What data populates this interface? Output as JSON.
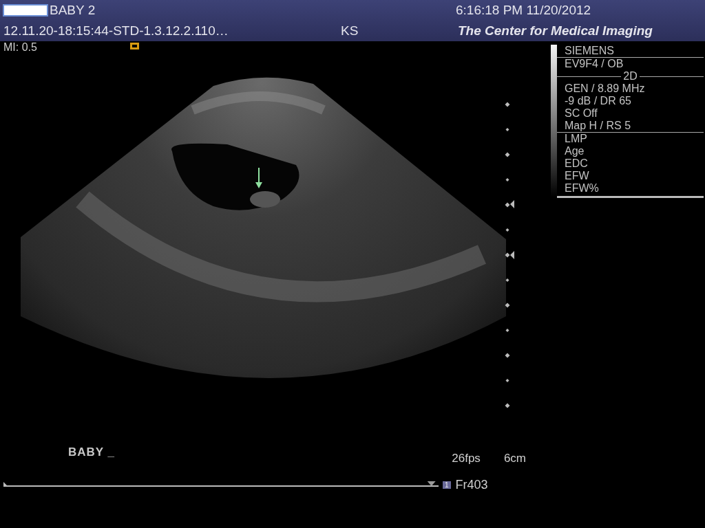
{
  "header": {
    "patient_name": "BABY 2",
    "datetime": "6:16:18 PM 11/20/2012",
    "study_id": "12.11.20-18:15:44-STD-1.3.12.2.110…",
    "operator": "KS",
    "institution": "The Center for Medical Imaging"
  },
  "mi": "MI: 0.5",
  "info_panel": {
    "manufacturer": "SIEMENS",
    "transducer": "EV9F4 / OB",
    "mode": "2D",
    "settings": [
      "GEN / 8.89 MHz",
      "-9 dB / DR 65",
      "SC Off",
      "Map H / RS 5"
    ],
    "ob_fields": [
      "LMP",
      "Age",
      "EDC",
      "EFW",
      "EFW%"
    ]
  },
  "annotation": "BABY _",
  "frame_rate": "26fps",
  "depth": "6cm",
  "cine": {
    "level": 0.99,
    "badge": "1",
    "frame": "Fr403"
  }
}
